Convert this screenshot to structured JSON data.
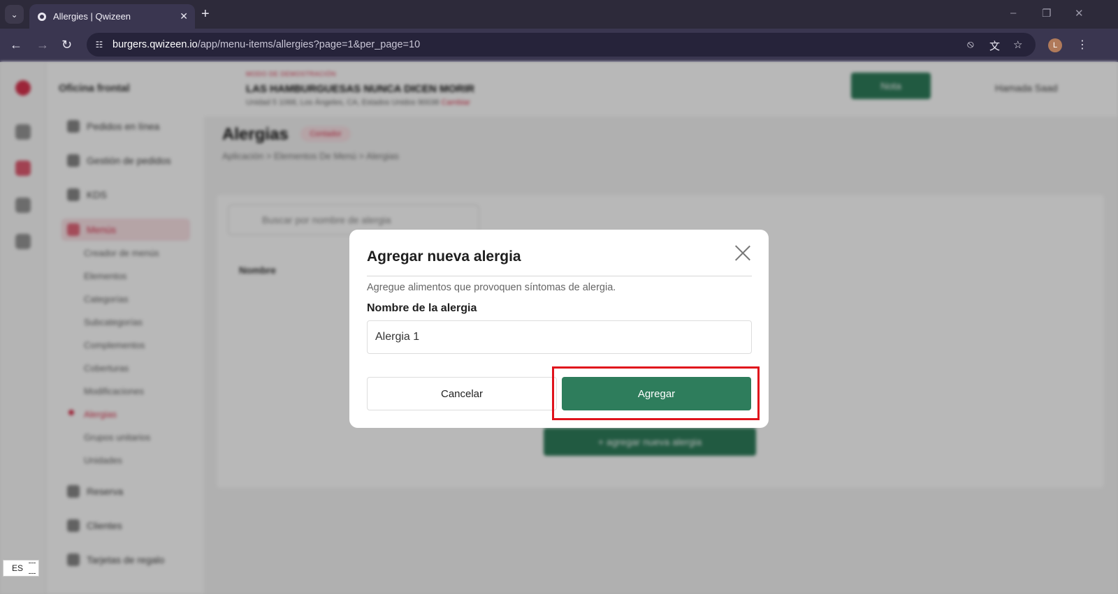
{
  "browser": {
    "tab_title": "Allergies | Qwizeen",
    "tab_menu_icon": "chevron-down-icon",
    "new_tab_symbol": "+",
    "url_host": "burgers.qwizeen.io",
    "url_path": "/app/menu-items/allergies?page=1&per_page=10",
    "profile_initial": "L"
  },
  "app": {
    "sidebar": {
      "title": "Oficina frontal",
      "items": [
        {
          "label": "Pedidos en línea"
        },
        {
          "label": "Gestión de pedidos"
        },
        {
          "label": "KDS"
        },
        {
          "label": "Menús"
        },
        {
          "label": "Reserva"
        },
        {
          "label": "Clientes"
        },
        {
          "label": "Tarjetas de regalo"
        }
      ],
      "subitems": [
        {
          "label": "Creador de menús"
        },
        {
          "label": "Elementos"
        },
        {
          "label": "Categorías"
        },
        {
          "label": "Subcategorías"
        },
        {
          "label": "Complementos"
        },
        {
          "label": "Coberturas"
        },
        {
          "label": "Modificaciones"
        },
        {
          "label": "Alergias"
        },
        {
          "label": "Grupos unitarios"
        },
        {
          "label": "Unidades"
        }
      ]
    },
    "header": {
      "demo_tag": "MODO DE DEMOSTRACIÓN",
      "restaurant_name": "LAS HAMBURGUESAS NUNCA DICEN MORIR",
      "restaurant_address": "Unidad 5 1068, Los Ángeles, CA, Estados Unidos 90038",
      "address_link": "Cambiar",
      "action_button": "Nota",
      "user_name": "Hamada Saad"
    },
    "page": {
      "title": "Alergias",
      "title_badge": "Contador",
      "breadcrumb": "Aplicación  >  Elementos De Menú  >  Alergias",
      "search_placeholder": "Buscar por nombre de alergia",
      "column_header": "Nombre",
      "add_button": "+ agregar nueva alergia"
    }
  },
  "modal": {
    "title": "Agregar nueva alergia",
    "description": "Agregue alimentos que provoquen síntomas de alergia.",
    "field_label": "Nombre de la alergia",
    "field_value": "Alergia 1",
    "cancel_label": "Cancelar",
    "submit_label": "Agregar",
    "highlight_color": "#e0131c",
    "accent_color": "#2e7d5c"
  },
  "lang_widget": {
    "label": "ES"
  }
}
